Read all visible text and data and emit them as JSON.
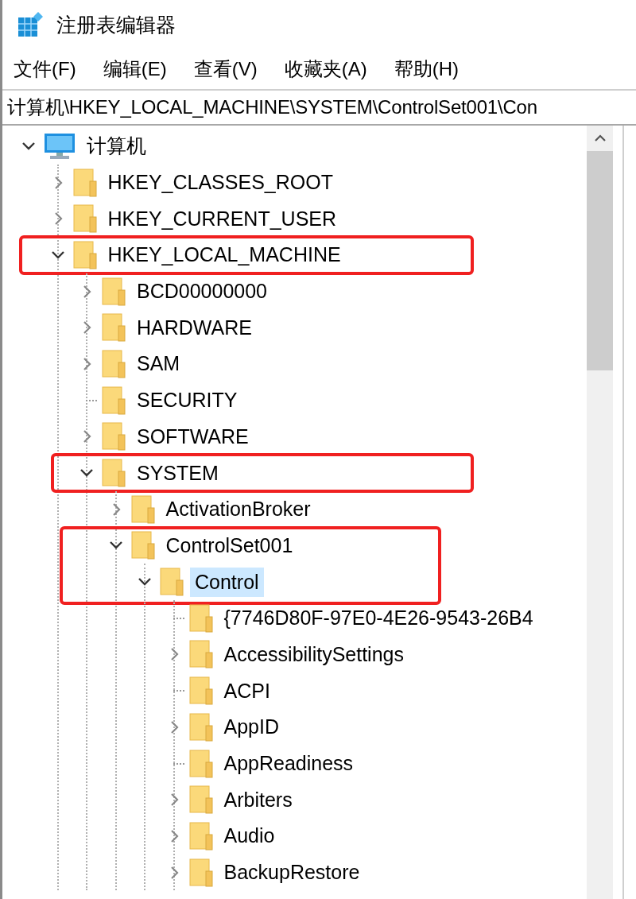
{
  "window": {
    "title": "注册表编辑器"
  },
  "menu": [
    {
      "label": "文件(F)"
    },
    {
      "label": "编辑(E)"
    },
    {
      "label": "查看(V)"
    },
    {
      "label": "收藏夹(A)"
    },
    {
      "label": "帮助(H)"
    }
  ],
  "address_bar": {
    "value": "计算机\\HKEY_LOCAL_MACHINE\\SYSTEM\\ControlSet001\\Con"
  },
  "tree": [
    {
      "label": "计算机",
      "kind": "computer",
      "expanded": true,
      "selected": false,
      "outlined": false,
      "children": [
        {
          "label": "HKEY_CLASSES_ROOT",
          "kind": "branch",
          "expanded": false,
          "selected": false,
          "outlined": false
        },
        {
          "label": "HKEY_CURRENT_USER",
          "kind": "branch",
          "expanded": false,
          "selected": false,
          "outlined": false
        },
        {
          "label": "HKEY_LOCAL_MACHINE",
          "kind": "branch",
          "expanded": true,
          "selected": false,
          "outlined": true,
          "children": [
            {
              "label": "BCD00000000",
              "kind": "branch",
              "expanded": false,
              "selected": false,
              "outlined": false
            },
            {
              "label": "HARDWARE",
              "kind": "branch",
              "expanded": false,
              "selected": false,
              "outlined": false
            },
            {
              "label": "SAM",
              "kind": "branch",
              "expanded": false,
              "selected": false,
              "outlined": false
            },
            {
              "label": "SECURITY",
              "kind": "leaf",
              "selected": false,
              "outlined": false
            },
            {
              "label": "SOFTWARE",
              "kind": "branch",
              "expanded": false,
              "selected": false,
              "outlined": false
            },
            {
              "label": "SYSTEM",
              "kind": "branch",
              "expanded": true,
              "selected": false,
              "outlined": true,
              "children": [
                {
                  "label": "ActivationBroker",
                  "kind": "branch",
                  "expanded": false,
                  "selected": false,
                  "outlined": false
                },
                {
                  "label": "ControlSet001",
                  "kind": "branch",
                  "expanded": true,
                  "selected": false,
                  "outlined": true,
                  "children": [
                    {
                      "label": "Control",
                      "kind": "branch",
                      "expanded": true,
                      "selected": true,
                      "outlined": true,
                      "children": [
                        {
                          "label": "{7746D80F-97E0-4E26-9543-26B4",
                          "kind": "leaf",
                          "selected": false,
                          "outlined": false
                        },
                        {
                          "label": "AccessibilitySettings",
                          "kind": "branch",
                          "expanded": false,
                          "selected": false,
                          "outlined": false
                        },
                        {
                          "label": "ACPI",
                          "kind": "leaf",
                          "selected": false,
                          "outlined": false
                        },
                        {
                          "label": "AppID",
                          "kind": "branch",
                          "expanded": false,
                          "selected": false,
                          "outlined": false
                        },
                        {
                          "label": "AppReadiness",
                          "kind": "leaf",
                          "selected": false,
                          "outlined": false
                        },
                        {
                          "label": "Arbiters",
                          "kind": "branch",
                          "expanded": false,
                          "selected": false,
                          "outlined": false
                        },
                        {
                          "label": "Audio",
                          "kind": "branch",
                          "expanded": false,
                          "selected": false,
                          "outlined": false
                        },
                        {
                          "label": "BackupRestore",
                          "kind": "branch",
                          "expanded": false,
                          "selected": false,
                          "outlined": false
                        }
                      ]
                    }
                  ]
                }
              ]
            }
          ]
        }
      ]
    }
  ]
}
